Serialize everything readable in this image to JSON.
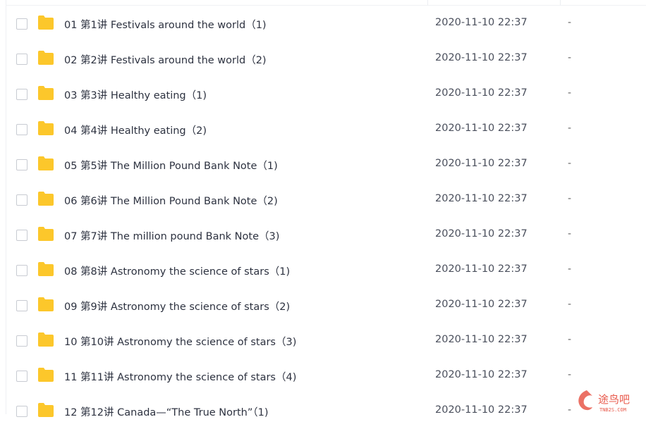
{
  "files": [
    {
      "name": "01 第1讲 Festivals around the world（1)",
      "date": "2020-11-10 22:37",
      "size": "-"
    },
    {
      "name": "02 第2讲 Festivals around the world（2)",
      "date": "2020-11-10 22:37",
      "size": "-"
    },
    {
      "name": "03 第3讲 Healthy eating（1)",
      "date": "2020-11-10 22:37",
      "size": "-"
    },
    {
      "name": "04 第4讲 Healthy eating（2)",
      "date": "2020-11-10 22:37",
      "size": "-"
    },
    {
      "name": "05 第5讲 The Million Pound Bank Note（1)",
      "date": "2020-11-10 22:37",
      "size": "-"
    },
    {
      "name": "06 第6讲 The Million Pound Bank Note（2)",
      "date": "2020-11-10 22:37",
      "size": "-"
    },
    {
      "name": "07 第7讲 The million pound Bank Note（3)",
      "date": "2020-11-10 22:37",
      "size": "-"
    },
    {
      "name": "08 第8讲 Astronomy the science of stars（1)",
      "date": "2020-11-10 22:37",
      "size": "-"
    },
    {
      "name": "09 第9讲 Astronomy the science of stars（2)",
      "date": "2020-11-10 22:37",
      "size": "-"
    },
    {
      "name": "10 第10讲 Astronomy the science of stars（3)",
      "date": "2020-11-10 22:37",
      "size": "-"
    },
    {
      "name": "11 第11讲 Astronomy the science of stars（4)",
      "date": "2020-11-10 22:37",
      "size": "-"
    },
    {
      "name": "12 第12讲 Canada—“The True North”（1)",
      "date": "2020-11-10 22:37",
      "size": "-"
    }
  ],
  "icons": {
    "folder": "folder-icon",
    "checkbox": "checkbox"
  },
  "colors": {
    "folder": "#fcc72b",
    "text": "#2d3240"
  },
  "watermark": {
    "text": "途鸟吧",
    "sub": "TNB2S.COM"
  }
}
